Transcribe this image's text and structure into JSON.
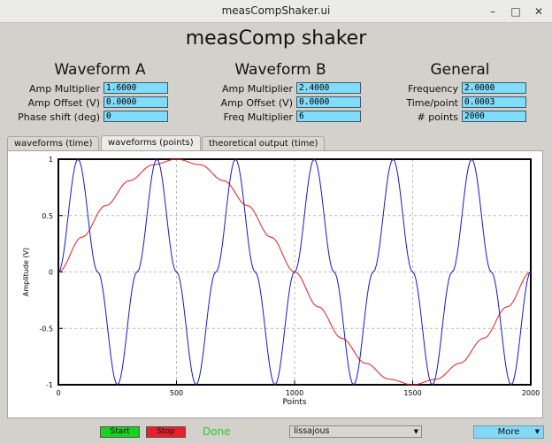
{
  "window": {
    "title": "measCompShaker.ui"
  },
  "app": {
    "title": "measComp shaker"
  },
  "waveform_a": {
    "heading": "Waveform A",
    "fields": [
      {
        "label": "Amp Multiplier",
        "value": "1.6000"
      },
      {
        "label": "Amp Offset (V)",
        "value": "0.0000"
      },
      {
        "label": "Phase shift (deg)",
        "value": "0"
      }
    ]
  },
  "waveform_b": {
    "heading": "Waveform B",
    "fields": [
      {
        "label": "Amp Multiplier",
        "value": "2.4000"
      },
      {
        "label": "Amp Offset (V)",
        "value": "0.0000"
      },
      {
        "label": "Freq Multiplier",
        "value": "6"
      }
    ]
  },
  "general": {
    "heading": "General",
    "fields": [
      {
        "label": "Frequency",
        "value": "2.0000"
      },
      {
        "label": "Time/point",
        "value": "0.0003"
      },
      {
        "label": "# points",
        "value": "2000"
      }
    ]
  },
  "tabs": [
    {
      "label": "waveforms (time)",
      "active": false
    },
    {
      "label": "waveforms (points)",
      "active": true
    },
    {
      "label": "theoretical output (time)",
      "active": false
    }
  ],
  "controls": {
    "start_label": "Start",
    "stop_label": "Stop",
    "status": "Done",
    "mode_value": "lissajous",
    "more_label": "More"
  },
  "colors": {
    "field_bg": "#7fdcfb",
    "start_bg": "#19d11e",
    "stop_bg": "#e8202c",
    "status": "#2ec92e",
    "series_a": "#e01b1b",
    "series_b": "#1717c9"
  },
  "chart_data": {
    "type": "line",
    "xlabel": "Points",
    "ylabel": "Amplitude (V)",
    "xlim": [
      0,
      2000
    ],
    "ylim": [
      -1,
      1
    ],
    "xticks": [
      0,
      500,
      1000,
      1500,
      2000
    ],
    "yticks": [
      -1,
      -0.5,
      0,
      0.5,
      1
    ],
    "ytick_labels": [
      "-1",
      "-0.5",
      "0",
      "0.5",
      "1"
    ],
    "grid": true,
    "series": [
      {
        "color": "#e01b1b",
        "x": [
          0,
          100,
          200,
          300,
          400,
          500,
          600,
          700,
          800,
          900,
          1000,
          1100,
          1200,
          1300,
          1400,
          1500,
          1600,
          1700,
          1800,
          1900,
          2000
        ],
        "y": [
          0,
          0.309,
          0.588,
          0.809,
          0.951,
          1,
          0.951,
          0.809,
          0.588,
          0.309,
          0,
          -0.309,
          -0.588,
          -0.809,
          -0.951,
          -1,
          -0.951,
          -0.809,
          -0.588,
          -0.309,
          0
        ]
      },
      {
        "color": "#1717c9",
        "x": [
          0,
          83,
          167,
          250,
          333,
          417,
          500,
          583,
          667,
          750,
          833,
          917,
          1000,
          1083,
          1167,
          1250,
          1333,
          1417,
          1500,
          1583,
          1667,
          1750,
          1833,
          1917,
          2000
        ],
        "y": [
          0,
          1,
          0,
          -1,
          0,
          1,
          0,
          -1,
          0,
          1,
          0,
          -1,
          0,
          1,
          0,
          -1,
          0,
          1,
          0,
          -1,
          0,
          1,
          0,
          -1,
          0
        ]
      }
    ]
  }
}
